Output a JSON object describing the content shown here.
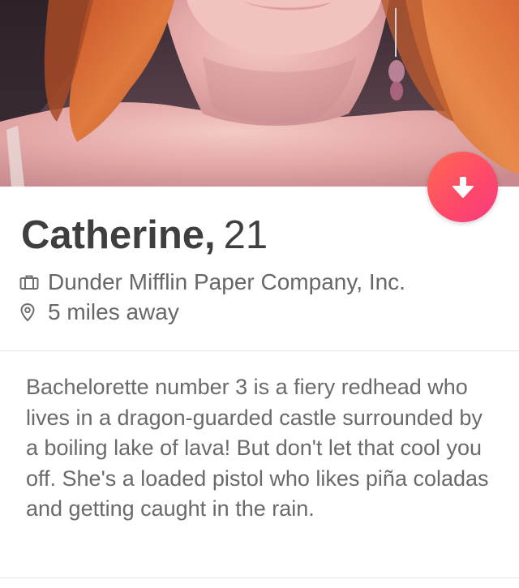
{
  "profile": {
    "name": "Catherine,",
    "age": "21",
    "job": "Dunder Mifflin Paper Company, Inc.",
    "distance": "5 miles away",
    "bio": "Bachelorette number 3 is a fiery redhead who lives in a dragon-guarded castle surrounded by a boiling lake of lava! But don't let that cool you off. She's a loaded pistol who likes piña coladas and getting caught in the rain."
  },
  "icons": {
    "job": "briefcase-icon",
    "distance": "location-pin-icon",
    "collapse": "arrow-down-icon"
  },
  "colors": {
    "accent_start": "#ff6a52",
    "accent_end": "#f83a7f",
    "name_text": "#3f3f3f",
    "meta_text": "#676767",
    "bio_text": "#6a6a6a"
  }
}
